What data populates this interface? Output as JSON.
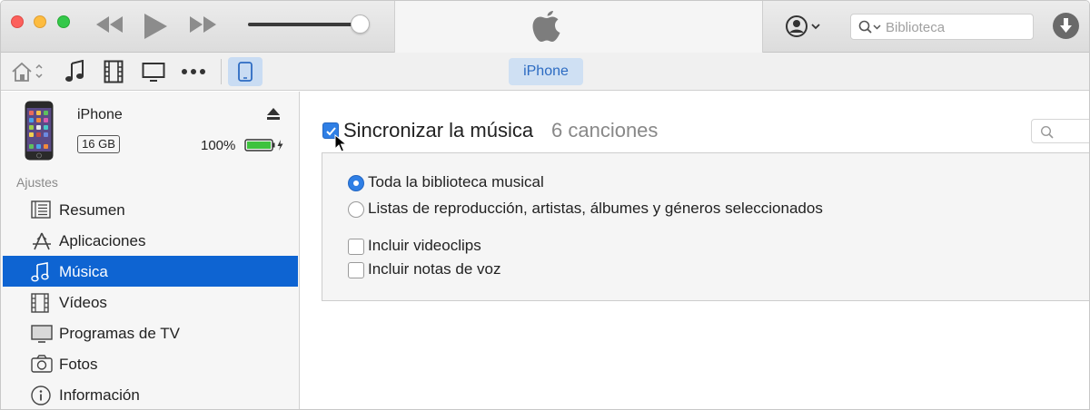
{
  "titlebar": {
    "icons": {
      "prev": "rewind-icon",
      "play": "play-icon",
      "next": "fast-forward-icon",
      "logo": "apple-logo-icon",
      "account": "account-icon",
      "download": "download-icon"
    },
    "volume_level": 0.9,
    "search": {
      "placeholder": "Biblioteca",
      "value": ""
    }
  },
  "toolbar": {
    "items": [
      "home-icon",
      "music-note-icon",
      "film-icon",
      "tv-icon",
      "more-icon",
      "iphone-icon"
    ],
    "device_button_label": "iPhone"
  },
  "device": {
    "name": "iPhone",
    "capacity": "16 GB",
    "battery": "100%"
  },
  "sidebar": {
    "section_label": "Ajustes",
    "items": [
      {
        "label": "Resumen",
        "icon": "summary-icon",
        "active": false
      },
      {
        "label": "Aplicaciones",
        "icon": "apps-icon",
        "active": false
      },
      {
        "label": "Música",
        "icon": "music-note-icon",
        "active": true
      },
      {
        "label": "Vídeos",
        "icon": "film-icon",
        "active": false
      },
      {
        "label": "Programas de TV",
        "icon": "tv-icon",
        "active": false
      },
      {
        "label": "Fotos",
        "icon": "camera-icon",
        "active": false
      },
      {
        "label": "Información",
        "icon": "info-icon",
        "active": false
      }
    ]
  },
  "main": {
    "sync_checked": true,
    "sync_title": "Sincronizar la música",
    "song_count": "6 canciones",
    "options": {
      "radio_all": {
        "label": "Toda la biblioteca musical",
        "selected": true
      },
      "radio_selected": {
        "label": "Listas de reproducción, artistas, álbumes y géneros seleccionados",
        "selected": false
      },
      "check_videoclips": {
        "label": "Incluir videoclips",
        "checked": false
      },
      "check_voice_notes": {
        "label": "Incluir notas de voz",
        "checked": false
      }
    }
  },
  "colors": {
    "accent": "#2f7fe5",
    "sidebar_active": "#0e64d2",
    "device_pill_bg": "#cfe0f3",
    "device_pill_text": "#2c6bc2"
  }
}
